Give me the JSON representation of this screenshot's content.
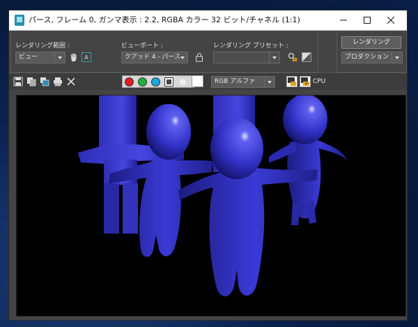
{
  "window": {
    "title": "パース, フレーム 0, ガンマ表示 : 2.2, RGBA カラー 32 ビット/チャネル (1:1)"
  },
  "render_panel": {
    "area_label": "レンダリング範囲 :",
    "area_value": "ビュー",
    "viewport_label": "ビューポート :",
    "viewport_value": "クアッド 4 - パース",
    "preset_label": "レンダリング プリセット :",
    "preset_value": "",
    "render_button": "レンダリング",
    "mode_value": "プロダクション"
  },
  "toolbar": {
    "channel_display": "RGB アルファ",
    "cpu_label": "CPU"
  },
  "colors": {
    "red_channel": "#e02020",
    "green_channel": "#22b040",
    "blue_channel": "#1aa8e0",
    "figure": "#3a3ad0"
  }
}
